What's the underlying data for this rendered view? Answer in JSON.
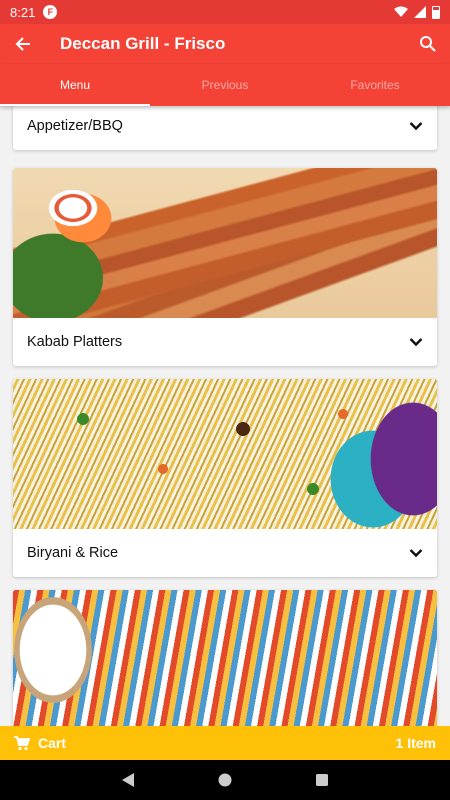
{
  "status_bar": {
    "time": "8:21",
    "app_badge": "F"
  },
  "app_bar": {
    "title": "Deccan Grill - Frisco",
    "back_icon": "arrow-left-icon",
    "search_icon": "search-icon"
  },
  "tabs": [
    {
      "label": "Menu",
      "active": true
    },
    {
      "label": "Previous",
      "active": false
    },
    {
      "label": "Favorites",
      "active": false
    }
  ],
  "categories": [
    {
      "label": "Appetizer/BBQ",
      "image": false
    },
    {
      "label": "Kabab Platters",
      "image": true,
      "image_desc": "kabab-photo"
    },
    {
      "label": "Biryani & Rice",
      "image": true,
      "image_desc": "biryani-photo"
    },
    {
      "label": "",
      "image": true,
      "image_desc": "curry-photo"
    }
  ],
  "cart": {
    "label": "Cart",
    "count_text": "1 Item"
  },
  "colors": {
    "primary": "#f44336",
    "status": "#e53935",
    "cart": "#ffc107"
  }
}
